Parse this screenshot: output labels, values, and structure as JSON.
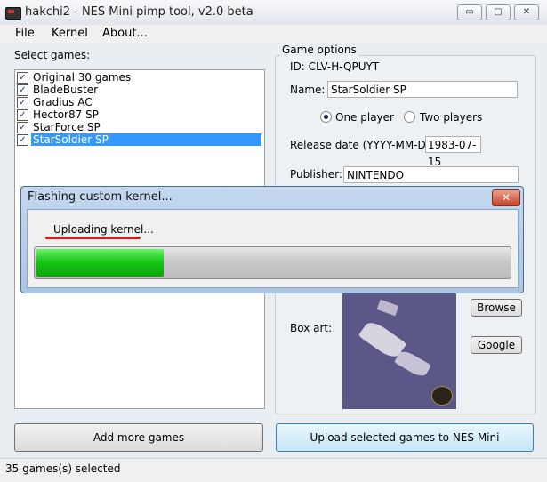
{
  "window": {
    "title": "hakchi2 - NES Mini pimp tool, v2.0 beta",
    "controls": {
      "minimize": "▭",
      "maximize": "▢",
      "close": "✕"
    }
  },
  "menu": {
    "file": "File",
    "kernel": "Kernel",
    "about": "About..."
  },
  "game_list": {
    "label": "Select games:",
    "items": [
      {
        "label": "Original 30 games",
        "checked": true
      },
      {
        "label": "BladeBuster",
        "checked": true
      },
      {
        "label": "Gradius AC",
        "checked": true
      },
      {
        "label": "Hector87 SP",
        "checked": true
      },
      {
        "label": "StarForce SP",
        "checked": true
      },
      {
        "label": "StarSoldier SP",
        "checked": true,
        "selected": true
      }
    ],
    "check_glyph": "✓"
  },
  "game_options": {
    "title": "Game options",
    "id_text": "ID: CLV-H-QPUYT",
    "name_label": "Name:",
    "name_value": "StarSoldier SP",
    "one_player": "One player",
    "two_players": "Two players",
    "release_label": "Release date (YYYY-MM-DD)",
    "release_value": "1983-07-15",
    "publisher_label": "Publisher:",
    "publisher_value": "NINTENDO",
    "box_art_label": "Box art:",
    "browse": "Browse",
    "google": "Google"
  },
  "buttons": {
    "add_more": "Add more games",
    "upload": "Upload selected games to NES Mini"
  },
  "status": "35 games(s) selected",
  "dialog": {
    "title": "Flashing custom kernel...",
    "close": "✕",
    "message": "Uploading kernel...",
    "progress_fraction": 0.27,
    "progress_color": "#17c617"
  }
}
